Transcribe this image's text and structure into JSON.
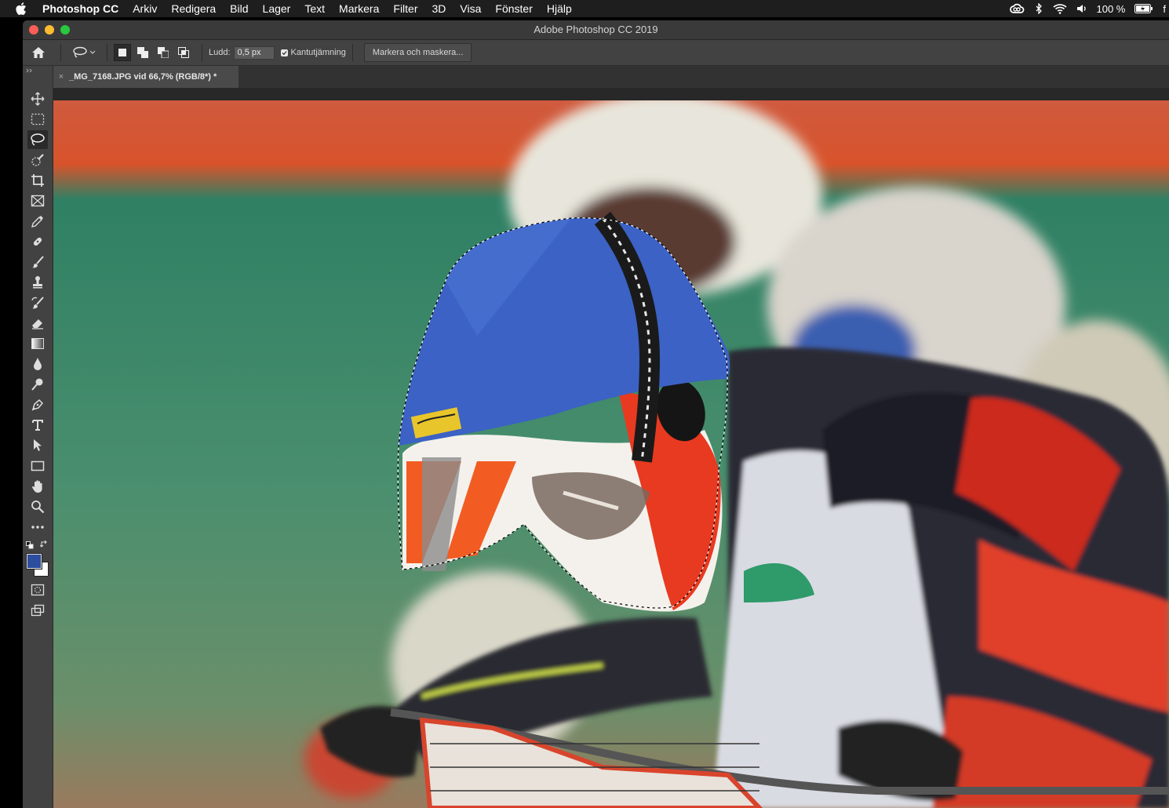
{
  "menubar": {
    "app_name": "Photoshop CC",
    "items": [
      "Arkiv",
      "Redigera",
      "Bild",
      "Lager",
      "Text",
      "Markera",
      "Filter",
      "3D",
      "Visa",
      "Fönster",
      "Hjälp"
    ],
    "battery": "100 %",
    "cut_text": "f"
  },
  "window": {
    "title": "Adobe Photoshop CC 2019"
  },
  "options": {
    "feather_label": "Ludd:",
    "feather_value": "0,5 px",
    "antialias_label": "Kantutjämning",
    "select_mask_button": "Markera och maskera..."
  },
  "document": {
    "tab_title": "_MG_7168.JPG vid 66,7% (RGB/8*) *",
    "close_glyph": "×"
  },
  "colors": {
    "foreground": "#2d4e9e",
    "background": "#ffffff",
    "helmet_cover": "#3b62c4",
    "track_green": "#4a8f6e",
    "track_red": "#d8532b"
  },
  "icons": [
    "apple-icon",
    "creative-cloud-icon",
    "bluetooth-icon",
    "wifi-icon",
    "volume-icon",
    "battery-icon",
    "home-icon",
    "lasso-icon"
  ]
}
